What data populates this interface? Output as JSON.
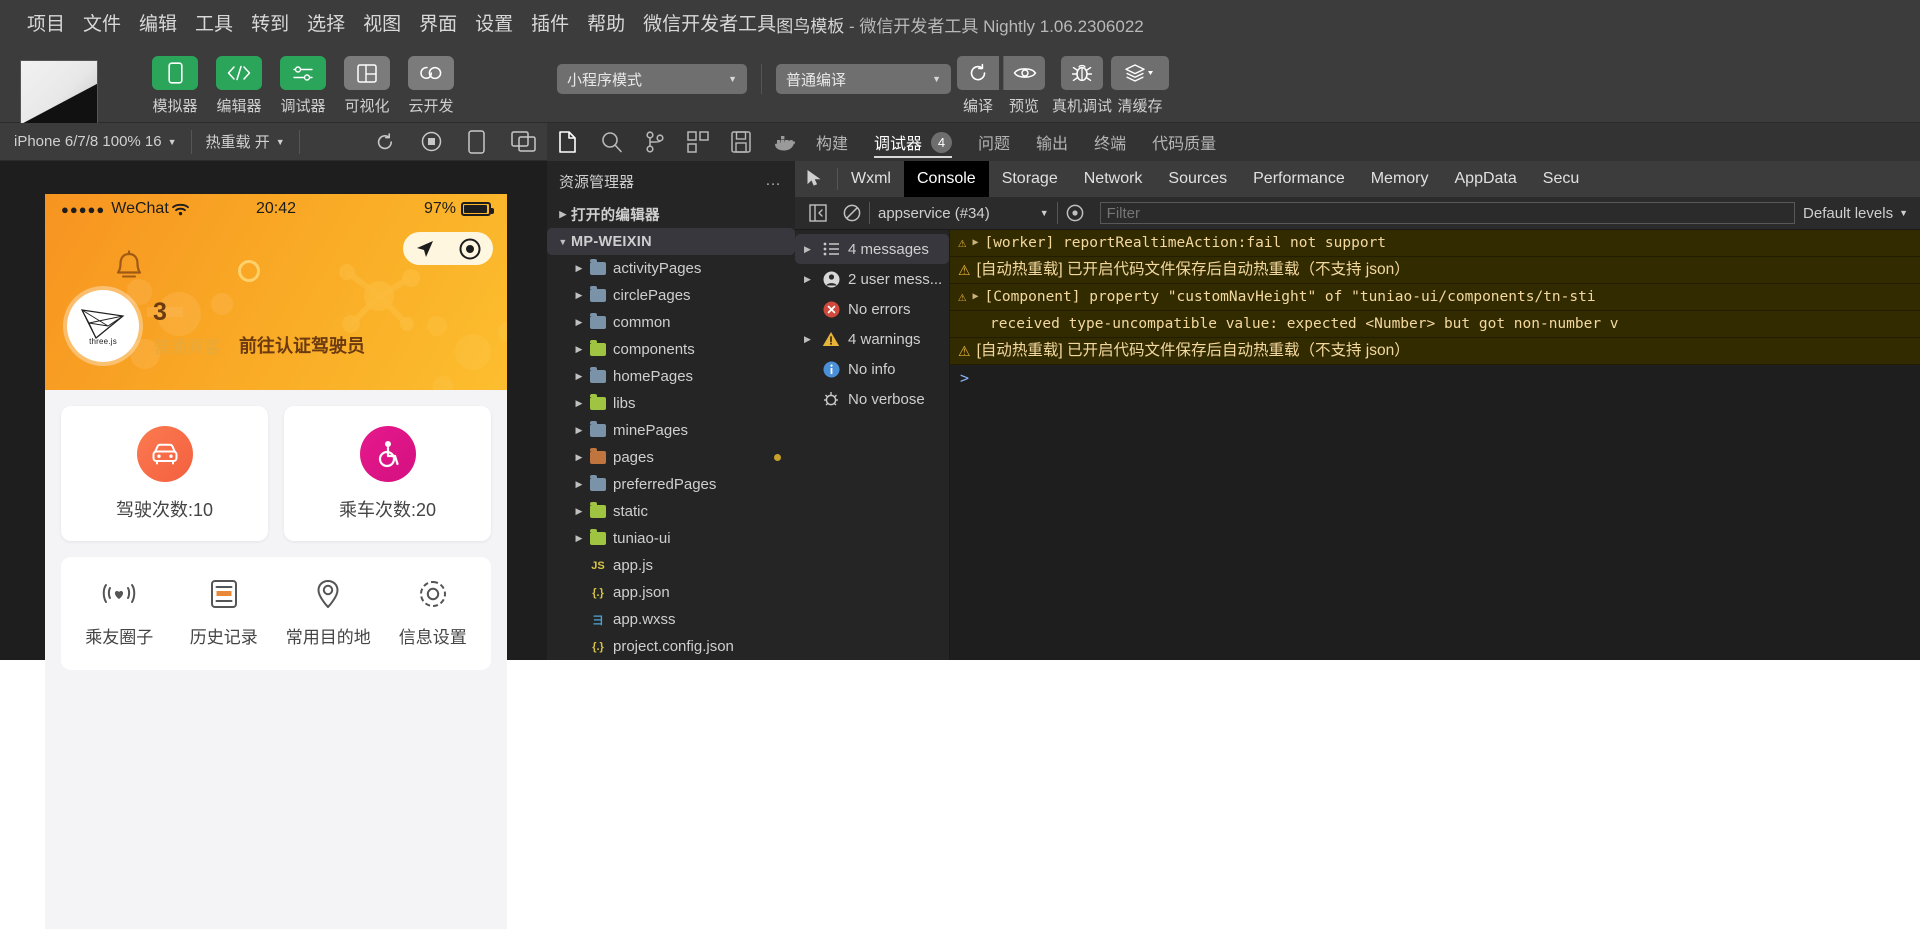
{
  "titlebar": {
    "menus": [
      "项目",
      "文件",
      "编辑",
      "工具",
      "转到",
      "选择",
      "视图",
      "界面",
      "设置",
      "插件",
      "帮助",
      "微信开发者工具"
    ],
    "doc_title": "图鸟模板",
    "app_title": "微信开发者工具 Nightly 1.06.2306022",
    "separator": " - "
  },
  "toolbar": {
    "tools": [
      {
        "label": "模拟器",
        "icon": "phone-icon",
        "state": "active"
      },
      {
        "label": "编辑器",
        "icon": "code-icon",
        "state": "active"
      },
      {
        "label": "调试器",
        "icon": "sliders-icon",
        "state": "active"
      },
      {
        "label": "可视化",
        "icon": "layout-icon",
        "state": "inactive"
      },
      {
        "label": "云开发",
        "icon": "cloud-icon",
        "state": "inactive"
      }
    ],
    "mode_select": "小程序模式",
    "compile_select": "普通编译",
    "actions": [
      {
        "label": "编译",
        "icon": "refresh-icon"
      },
      {
        "label": "预览",
        "icon": "eye-icon"
      },
      {
        "label": "真机调试",
        "icon": "bug-icon"
      },
      {
        "label": "清缓存",
        "icon": "layers-icon"
      }
    ],
    "accent_green": "#2ba55a",
    "grey": "#7b7b7b"
  },
  "simulator": {
    "device_select": "iPhone 6/7/8 100% 16",
    "hotreload_select": "热重载 开",
    "icons": [
      "refresh-icon",
      "record-icon",
      "rotate-icon",
      "multiscreen-icon"
    ],
    "phone": {
      "status": {
        "dots": "●●●●●",
        "carrier": "WeChat",
        "wifi": "wifi-icon",
        "time": "20:42",
        "battery": "97%"
      },
      "user": {
        "avatar_label": "three.js",
        "name": "3",
        "role": "普通乘客",
        "cert_link": "前往认证驾驶员"
      },
      "stat_cards": [
        {
          "label": "驾驶次数:10",
          "icon": "car-icon",
          "color": "#f4603f"
        },
        {
          "label": "乘车次数:20",
          "icon": "wheelchair-icon",
          "color": "#d4107f"
        }
      ],
      "menu_items": [
        {
          "label": "乘友圈子",
          "icon": "heart-circle-icon"
        },
        {
          "label": "历史记录",
          "icon": "history-icon"
        },
        {
          "label": "常用目的地",
          "icon": "location-icon"
        },
        {
          "label": "信息设置",
          "icon": "gear-icon"
        }
      ]
    }
  },
  "explorer": {
    "iconbar": [
      "files-icon",
      "search-icon",
      "source-control-icon",
      "extensions-icon",
      "save-icon",
      "docker-icon"
    ],
    "title": "资源管理器",
    "more": "…",
    "sections": [
      {
        "label": "打开的编辑器",
        "expanded": false
      },
      {
        "label": "MP-WEIXIN",
        "expanded": true,
        "selected": true
      }
    ],
    "files": [
      {
        "name": "activityPages",
        "type": "folder",
        "color": "blue",
        "expanded": false
      },
      {
        "name": "circlePages",
        "type": "folder",
        "color": "blue",
        "expanded": false
      },
      {
        "name": "common",
        "type": "folder",
        "color": "blue",
        "expanded": false
      },
      {
        "name": "components",
        "type": "folder",
        "color": "green",
        "expanded": false
      },
      {
        "name": "homePages",
        "type": "folder",
        "color": "blue",
        "expanded": false
      },
      {
        "name": "libs",
        "type": "folder",
        "color": "green",
        "expanded": false
      },
      {
        "name": "minePages",
        "type": "folder",
        "color": "blue",
        "expanded": false
      },
      {
        "name": "pages",
        "type": "folder",
        "color": "red",
        "expanded": false,
        "modified": true
      },
      {
        "name": "preferredPages",
        "type": "folder",
        "color": "blue",
        "expanded": false
      },
      {
        "name": "static",
        "type": "folder",
        "color": "green",
        "expanded": false
      },
      {
        "name": "tuniao-ui",
        "type": "folder",
        "color": "green",
        "expanded": false
      },
      {
        "name": "app.js",
        "type": "file",
        "icon_text": "JS",
        "icon_color": "#d8c545"
      },
      {
        "name": "app.json",
        "type": "file",
        "icon_text": "{.}",
        "icon_color": "#d8c545"
      },
      {
        "name": "app.wxss",
        "type": "file",
        "icon_text": "彐",
        "icon_color": "#4aa5d6"
      },
      {
        "name": "project.config.json",
        "type": "file",
        "icon_text": "{.}",
        "icon_color": "#d8c545"
      }
    ]
  },
  "devtools": {
    "top_tabs": [
      {
        "label": "构建",
        "active": false
      },
      {
        "label": "调试器",
        "active": true,
        "badge": "4"
      },
      {
        "label": "问题",
        "active": false
      },
      {
        "label": "输出",
        "active": false
      },
      {
        "label": "终端",
        "active": false
      },
      {
        "label": "代码质量",
        "active": false
      }
    ],
    "panel_tabs": [
      {
        "label": "Wxml",
        "active": false
      },
      {
        "label": "Console",
        "active": true
      },
      {
        "label": "Storage",
        "active": false
      },
      {
        "label": "Network",
        "active": false
      },
      {
        "label": "Sources",
        "active": false
      },
      {
        "label": "Performance",
        "active": false
      },
      {
        "label": "Memory",
        "active": false
      },
      {
        "label": "AppData",
        "active": false
      },
      {
        "label": "Secu",
        "active": false
      }
    ],
    "filterbar": {
      "context": "appservice (#34)",
      "filter_placeholder": "Filter",
      "levels": "Default levels"
    },
    "msg_sidebar": [
      {
        "label": "4 messages",
        "icon": "list-icon",
        "selected": true,
        "expandable": true
      },
      {
        "label": "2 user mess...",
        "icon": "user-icon",
        "selected": false,
        "expandable": true
      },
      {
        "label": "No errors",
        "icon": "error-icon",
        "selected": false,
        "expandable": false
      },
      {
        "label": "4 warnings",
        "icon": "warning-icon",
        "selected": false,
        "expandable": true
      },
      {
        "label": "No info",
        "icon": "info-icon",
        "selected": false,
        "expandable": false
      },
      {
        "label": "No verbose",
        "icon": "verbose-icon",
        "selected": false,
        "expandable": false
      }
    ],
    "logs": [
      {
        "level": "warning",
        "expandable": true,
        "mono": true,
        "text": "[worker] reportRealtimeAction:fail not support"
      },
      {
        "level": "warning",
        "expandable": false,
        "mono": false,
        "text": "[自动热重载] 已开启代码文件保存后自动热重载（不支持 json）"
      },
      {
        "level": "warning",
        "expandable": true,
        "mono": true,
        "text": "[Component] property \"customNavHeight\" of \"tuniao-ui/components/tn-sti"
      },
      {
        "level": "warning",
        "expandable": false,
        "mono": true,
        "indent": true,
        "text": "received type-uncompatible value: expected <Number> but got non-number v"
      },
      {
        "level": "warning",
        "expandable": false,
        "mono": false,
        "text": "[自动热重载] 已开启代码文件保存后自动热重载（不支持 json）"
      }
    ],
    "prompt": ">"
  }
}
